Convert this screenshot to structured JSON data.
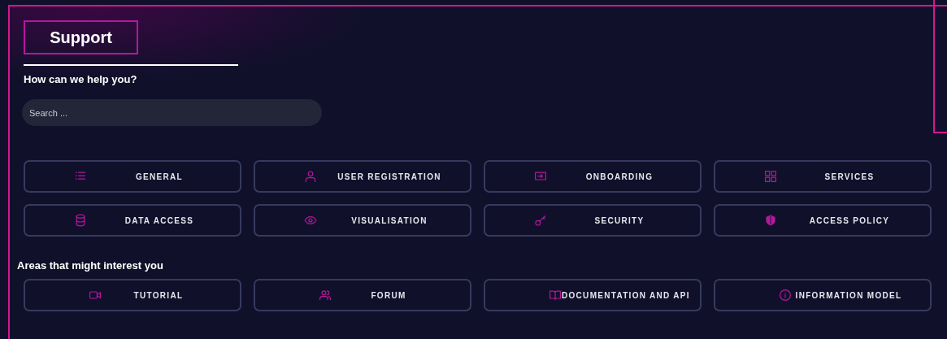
{
  "title": "Support",
  "subtitle": "How can we help you?",
  "search": {
    "placeholder": "Search ..."
  },
  "topics": [
    {
      "label": "GENERAL"
    },
    {
      "label": "USER REGISTRATION"
    },
    {
      "label": "ONBOARDING"
    },
    {
      "label": "SERVICES"
    },
    {
      "label": "DATA ACCESS"
    },
    {
      "label": "VISUALISATION"
    },
    {
      "label": "SECURITY"
    },
    {
      "label": "ACCESS POLICY"
    }
  ],
  "areas_heading": "Areas that might interest you",
  "areas": [
    {
      "label": "TUTORIAL"
    },
    {
      "label": "FORUM"
    },
    {
      "label": "DOCUMENTATION AND API"
    },
    {
      "label": "INFORMATION MODEL"
    }
  ]
}
